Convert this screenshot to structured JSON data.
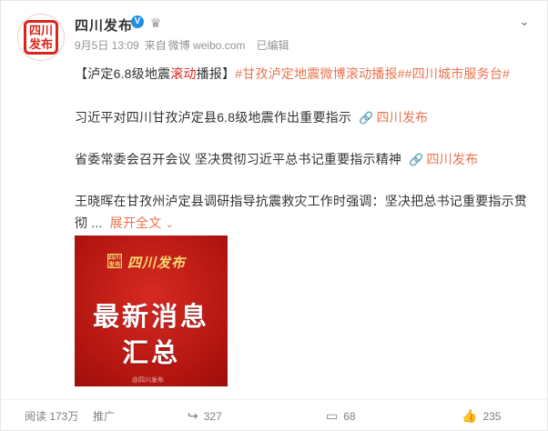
{
  "header": {
    "avatar_text": "四川发布",
    "name": "四川发布",
    "verified_mark": "V",
    "crown_icon": "crown-icon",
    "more_icon": "chevron-down-icon",
    "date": "9月5日 13:09",
    "source_prefix": "来自",
    "source": "微博 weibo.com",
    "edited": "已编辑"
  },
  "post": {
    "title_open": "【泸定6.8级地震",
    "title_red": "滚动",
    "title_close": "播报】",
    "hashtags": "#甘孜泸定地震微博滚动播报##四川城市服务台#",
    "items": [
      {
        "text": "习近平对四川甘孜泸定县6.8级地震作出重要指示",
        "link": "四川发布"
      },
      {
        "text": "省委常委会召开会议 坚决贯彻习近平总书记重要指示精神",
        "link": "四川发布"
      }
    ],
    "last_line1": "王晓晖在甘孜州泸定县调研指导抗震救灾工作时强调：坚决把总书记重要指示贯",
    "last_line2": "彻 ...",
    "expand": "展开全文"
  },
  "image": {
    "logo_text": "四川发布",
    "brand": "四川发布",
    "title_line1": "最新消息",
    "title_line2": "汇总",
    "watermark": "@四川发布"
  },
  "footer": {
    "reads": "阅读 173万",
    "promote": "推广",
    "forward_count": "327",
    "comment_count": "68",
    "like_count": "235"
  },
  "colors": {
    "accent_red": "#d9261c",
    "link_orange": "#eb7350",
    "verified_blue": "#1e8fe1"
  }
}
